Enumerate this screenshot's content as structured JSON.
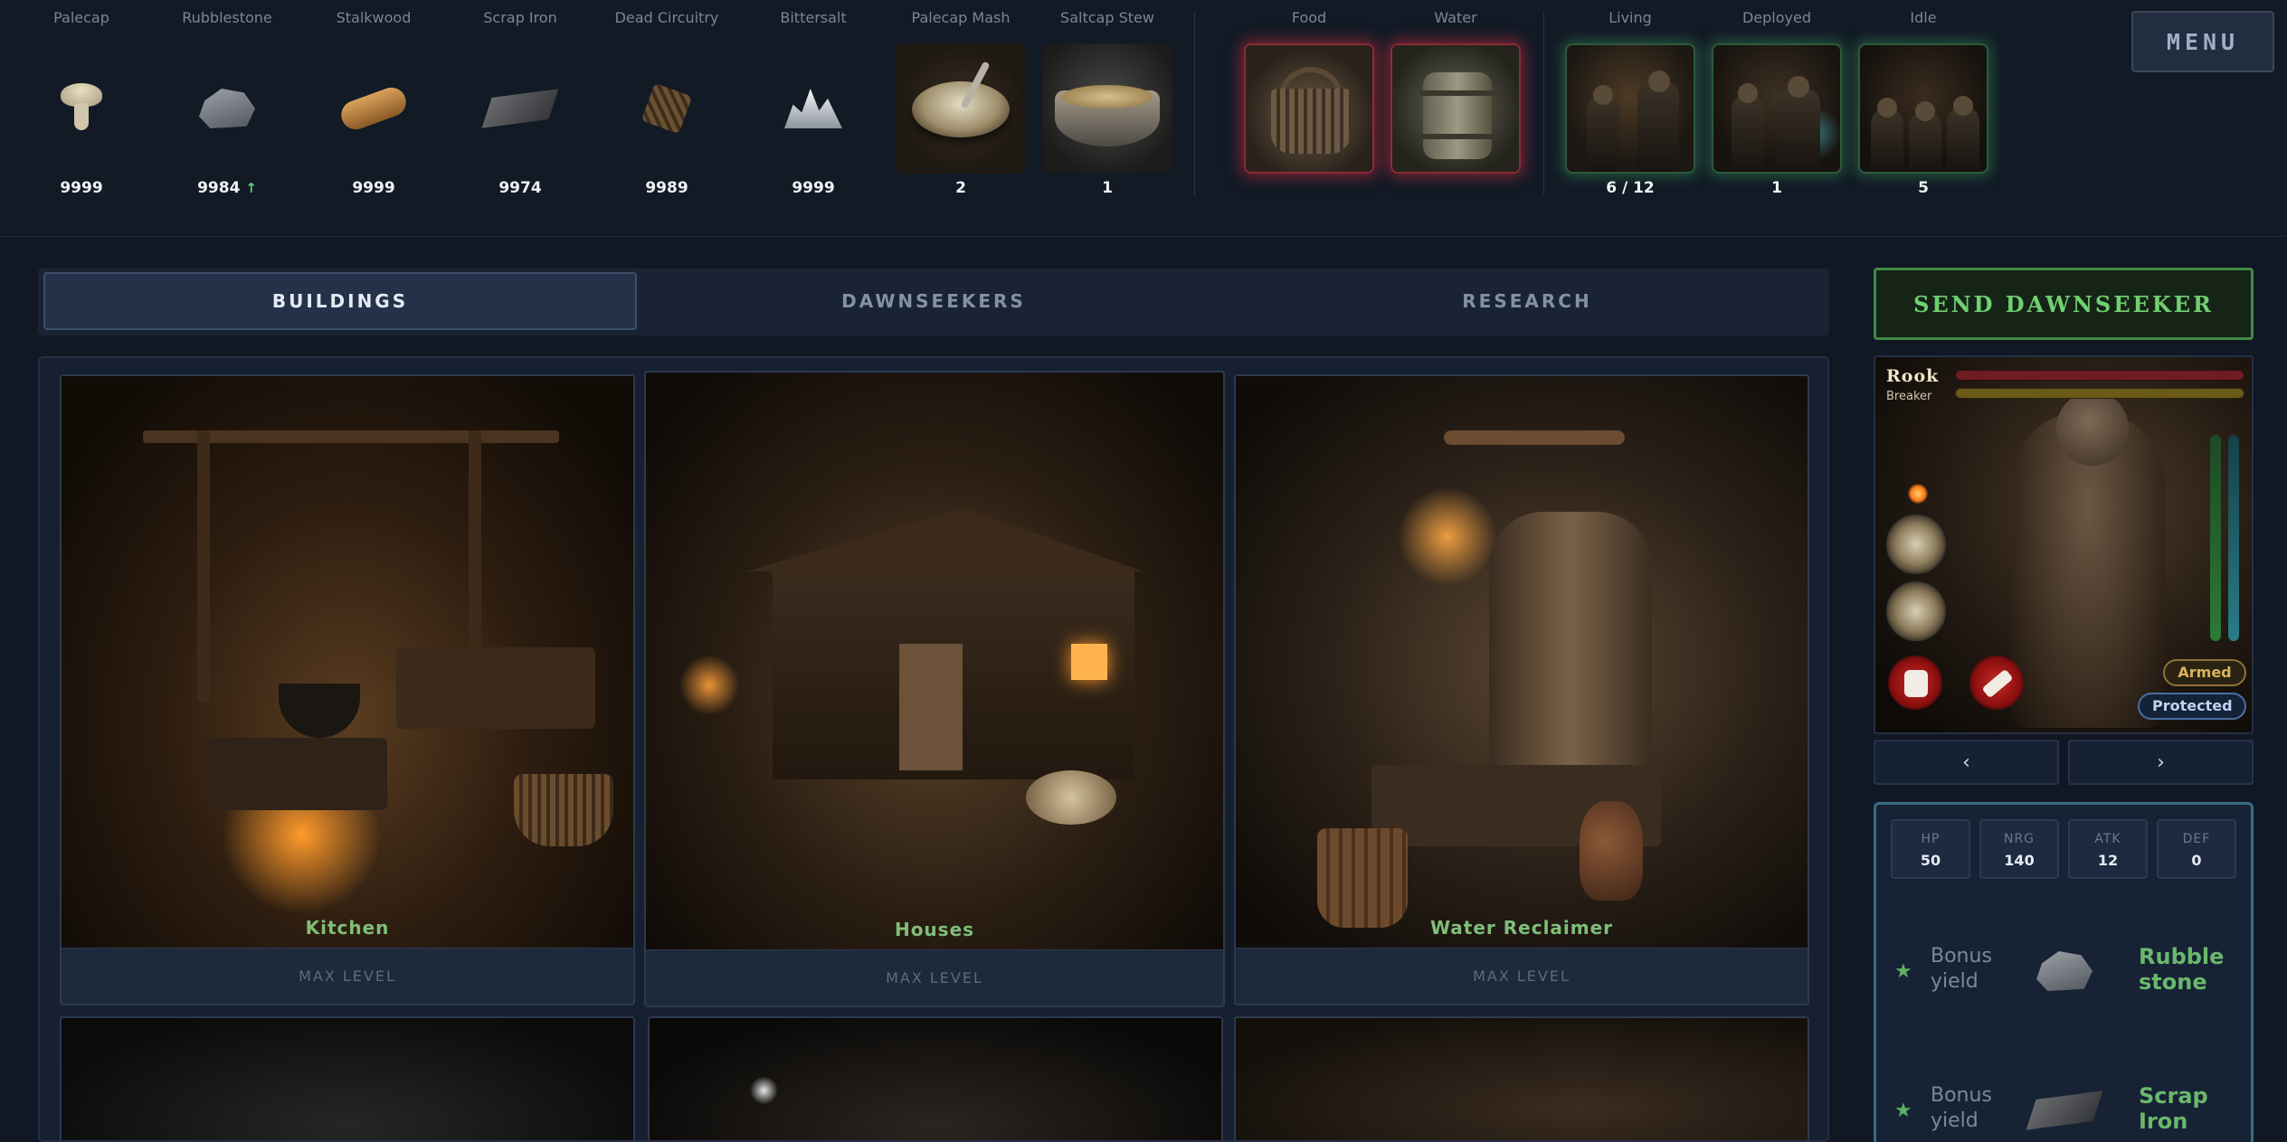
{
  "resources": [
    {
      "name": "Palecap",
      "count": "9999",
      "trend": "",
      "icon": "palecap-mushroom-icon"
    },
    {
      "name": "Rubblestone",
      "count": "9984",
      "trend": "↑",
      "icon": "rubblestone-icon"
    },
    {
      "name": "Stalkwood",
      "count": "9999",
      "trend": "",
      "icon": "stalkwood-log-icon"
    },
    {
      "name": "Scrap Iron",
      "count": "9974",
      "trend": "",
      "icon": "scrap-iron-icon"
    },
    {
      "name": "Dead Circuitry",
      "count": "9989",
      "trend": "",
      "icon": "dead-circuitry-icon"
    },
    {
      "name": "Bittersalt",
      "count": "9999",
      "trend": "",
      "icon": "bittersalt-icon"
    },
    {
      "name": "Palecap Mash",
      "count": "2",
      "trend": "",
      "icon": "palecap-mash-bowl-icon"
    },
    {
      "name": "Saltcap Stew",
      "count": "1",
      "trend": "",
      "icon": "saltcap-stew-pot-icon"
    }
  ],
  "needs": [
    {
      "name": "Food",
      "icon": "food-basket-icon",
      "status_color": "#c82d3c"
    },
    {
      "name": "Water",
      "icon": "water-barrel-icon",
      "status_color": "#c82d3c"
    }
  ],
  "population": [
    {
      "name": "Living",
      "count": "6 / 12"
    },
    {
      "name": "Deployed",
      "count": "1"
    },
    {
      "name": "Idle",
      "count": "5"
    }
  ],
  "menu_label": "MENU",
  "tabs": [
    {
      "label": "BUILDINGS",
      "active": true
    },
    {
      "label": "DAWNSEEKERS",
      "active": false
    },
    {
      "label": "RESEARCH",
      "active": false
    }
  ],
  "buildings": [
    {
      "name": "Kitchen",
      "status": "MAX LEVEL"
    },
    {
      "name": "Houses",
      "status": "MAX LEVEL"
    },
    {
      "name": "Water Reclaimer",
      "status": "MAX LEVEL"
    },
    {
      "name": "",
      "status": ""
    },
    {
      "name": "",
      "status": ""
    },
    {
      "name": "",
      "status": ""
    }
  ],
  "send_button": "SEND DAWNSEEKER",
  "dawnseeker": {
    "name": "Rook",
    "role": "Breaker",
    "tags": {
      "armed": "Armed",
      "protected": "Protected"
    },
    "nav": {
      "prev": "‹",
      "next": "›"
    },
    "stats": [
      {
        "label": "HP",
        "value": "50"
      },
      {
        "label": "NRG",
        "value": "140"
      },
      {
        "label": "ATK",
        "value": "12"
      },
      {
        "label": "DEF",
        "value": "0"
      }
    ],
    "bonuses": [
      {
        "prefix": "Bonus yield",
        "resource": "Rubble stone",
        "icon": "rubblestone-icon"
      },
      {
        "prefix": "Bonus yield",
        "resource": "Scrap Iron",
        "icon": "scrap-iron-icon"
      }
    ]
  },
  "colors": {
    "accent_green": "#6fd170",
    "need_red": "#c82d3c",
    "building_name": "#7fbf78",
    "background": "#111823"
  }
}
